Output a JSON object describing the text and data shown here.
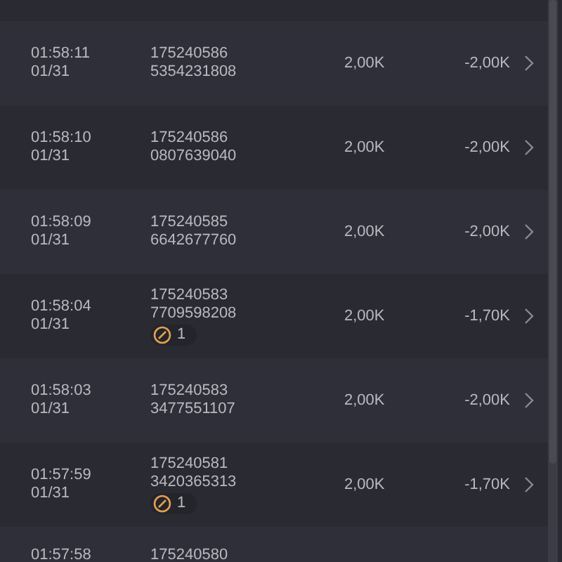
{
  "rows": [
    {
      "time": "01:58:11",
      "date": "01/31",
      "id_line_1": "175240586",
      "id_line_2": "5354231808",
      "amount": "2,00K",
      "result": "-2,00K"
    },
    {
      "time": "01:58:10",
      "date": "01/31",
      "id_line_1": "175240586",
      "id_line_2": "0807639040",
      "amount": "2,00K",
      "result": "-2,00K"
    },
    {
      "time": "01:58:09",
      "date": "01/31",
      "id_line_1": "175240585",
      "id_line_2": "6642677760",
      "amount": "2,00K",
      "result": "-2,00K"
    },
    {
      "time": "01:58:04",
      "date": "01/31",
      "id_line_1": "175240583",
      "id_line_2": "7709598208",
      "badge": "1",
      "amount": "2,00K",
      "result": "-1,70K"
    },
    {
      "time": "01:58:03",
      "date": "01/31",
      "id_line_1": "175240583",
      "id_line_2": "3477551107",
      "amount": "2,00K",
      "result": "-2,00K"
    },
    {
      "time": "01:57:59",
      "date": "01/31",
      "id_line_1": "175240581",
      "id_line_2": "3420365313",
      "badge": "1",
      "amount": "2,00K",
      "result": "-1,70K"
    },
    {
      "time": "01:57:58",
      "id_line_1": "175240580"
    }
  ]
}
